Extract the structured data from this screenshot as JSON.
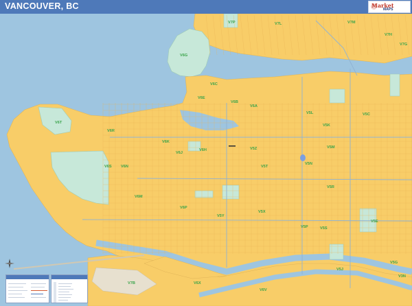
{
  "title": "VANCOUVER,  BC",
  "logo": {
    "brand": "Market",
    "sub": "MAPS"
  },
  "colors": {
    "water": "#9ec5e0",
    "land": "#f8cd68",
    "park": "#c7e8d9",
    "title_bar": "#4e79b9",
    "zip_label": "#3aa44a"
  },
  "zip_labels": [
    "V7P",
    "V7L",
    "V7M",
    "V7H",
    "V7G",
    "V6G",
    "V6E",
    "V6B",
    "V6C",
    "V6A",
    "V5L",
    "V5K",
    "V5C",
    "V6T",
    "V6R",
    "V6K",
    "V6J",
    "V6H",
    "V5Z",
    "V5T",
    "V5N",
    "V5M",
    "V5R",
    "V6S",
    "V6N",
    "V6M",
    "V6P",
    "V5Y",
    "V5X",
    "V5P",
    "V5S",
    "V5E",
    "V5J",
    "V7B",
    "V6X",
    "V6V",
    "V5G",
    "V3N"
  ],
  "icons": {
    "compass": "north-compass-icon"
  }
}
